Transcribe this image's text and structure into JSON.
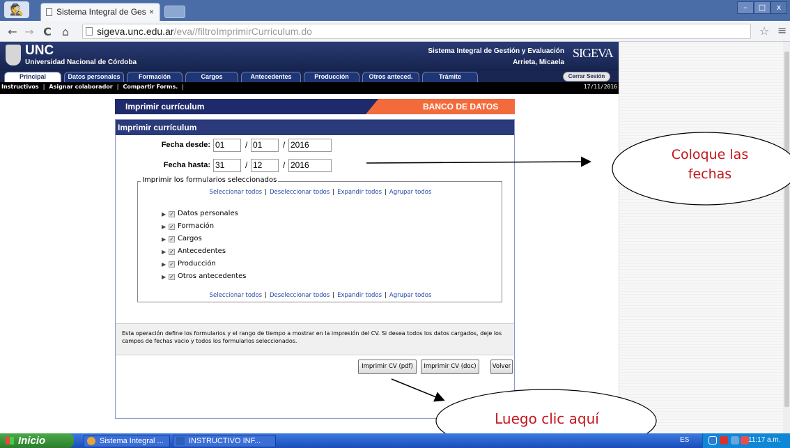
{
  "browser": {
    "tab_title": "Sistema Integral de Ges",
    "tab_close": "×",
    "url_host": "sigeva.unc.edu.ar",
    "url_path": "/eva//filtroImprimirCurriculum.do",
    "icons": [
      "back-icon",
      "forward-icon",
      "reload-icon",
      "home-icon",
      "star-icon",
      "menu-icon"
    ]
  },
  "header": {
    "unc_short": "UNC",
    "unc_long": "Universidad Nacional de Córdoba",
    "system_name": "Sistema Integral de Gestión y Evaluación",
    "user": "Arrieta, Micaela",
    "logo": "SIGEVA"
  },
  "tabs": [
    {
      "label": "Principal",
      "active": true
    },
    {
      "label": "Datos personales",
      "active": false
    },
    {
      "label": "Formación",
      "active": false
    },
    {
      "label": "Cargos",
      "active": false
    },
    {
      "label": "Antecedentes",
      "active": false
    },
    {
      "label": "Producción",
      "active": false
    },
    {
      "label": "Otros anteced.",
      "active": false
    },
    {
      "label": "Trámite",
      "active": false
    }
  ],
  "logout_label": "Cerrar Sesión",
  "subnav": {
    "links": [
      "Instructivos",
      "Asignar colaborador",
      "Compartir Forms."
    ],
    "date": "17/11/2016"
  },
  "page": {
    "title": "Imprimir currículum",
    "banner": "BANCO DE DATOS",
    "panel_title": "Imprimir currículum"
  },
  "form": {
    "fecha_desde_label": "Fecha desde:",
    "fecha_hasta_label": "Fecha hasta:",
    "desde": {
      "day": "01",
      "month": "01",
      "year": "2016"
    },
    "hasta": {
      "day": "31",
      "month": "12",
      "year": "2016"
    },
    "date_sep": "/",
    "legend": "Imprimir los formularios seleccionados",
    "links": [
      "Seleccionar todos",
      "Deseleccionar todos",
      "Expandir todos",
      "Agrupar todos"
    ],
    "link_sep": "|",
    "items": [
      "Datos personales",
      "Formación",
      "Cargos",
      "Antecedentes",
      "Producción",
      "Otros antecedentes"
    ],
    "info": "Esta operación define los formularios y el rango de tiempo a mostrar en la impresión del CV. Si desea todos los datos cargados, deje los campos de fechas vacio y todos los formularios seleccionados.",
    "buttons": {
      "pdf": "Imprimir CV (pdf)",
      "doc": "Imprimir CV (doc)",
      "back": "Volver"
    }
  },
  "annotations": {
    "callout_dates": "Coloque las fechas",
    "callout_click": "Luego clic aquí",
    "color": "#c3161c"
  },
  "taskbar": {
    "start": "Inicio",
    "tasks": [
      "Sistema Integral ...",
      "INSTRUCTIVO INF..."
    ],
    "lang": "ES",
    "clock": "11:17 a.m."
  }
}
